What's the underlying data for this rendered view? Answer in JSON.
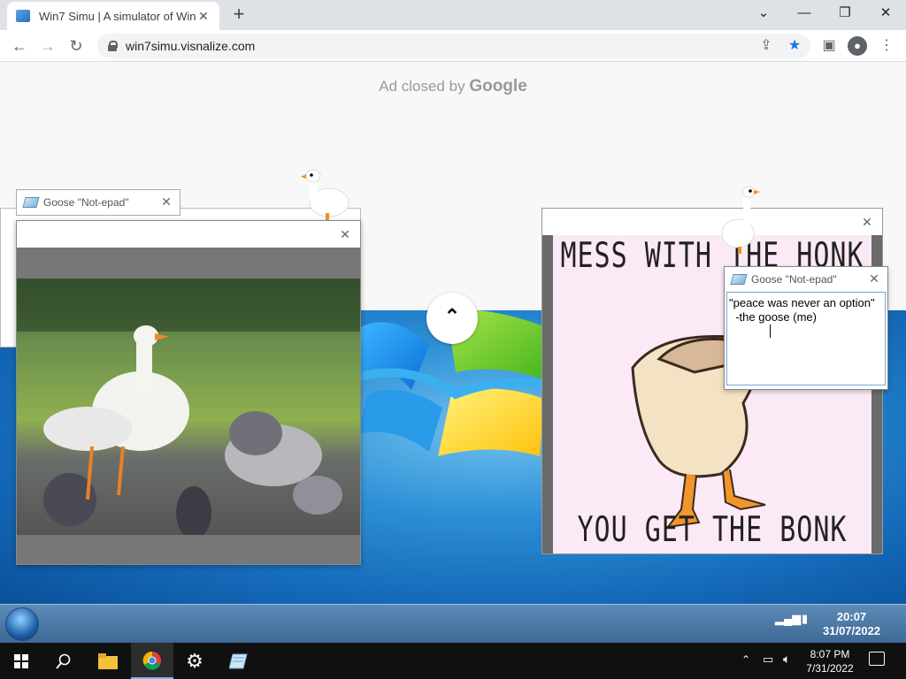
{
  "browser": {
    "tab_title": "Win7 Simu | A simulator of Wind",
    "tab_close": "✕",
    "new_tab": "+",
    "url": "win7simu.visnalize.com",
    "window_controls": [
      "⌄",
      "—",
      "❐",
      "✕"
    ],
    "ad_closed_by": "Ad closed by",
    "ad_brand": "Google"
  },
  "windows": {
    "small_notepad_title": "Goose \"Not-epad\"",
    "big_notepad_title": "Goose \"Not-epad\"",
    "big_notepad_lines": "\"peace was never an option\"\n  -the goose (me)",
    "close_glyph": "✕"
  },
  "meme": {
    "top_text": "MESS WITH THE HONK",
    "bottom_text": "YOU GET THE BONK"
  },
  "win7_taskbar": {
    "time": "20:07",
    "date": "31/07/2022"
  },
  "win10_taskbar": {
    "time": "8:07 PM",
    "date": "7/31/2022",
    "icons": [
      "windows-start-icon",
      "search-icon",
      "file-explorer-icon",
      "chrome-icon",
      "settings-gear-icon",
      "notepad-icon"
    ]
  },
  "colors": {
    "win7_desktop": "#1469b8",
    "meme_bg": "#fbe9f6",
    "taskbar10": "#101010"
  }
}
